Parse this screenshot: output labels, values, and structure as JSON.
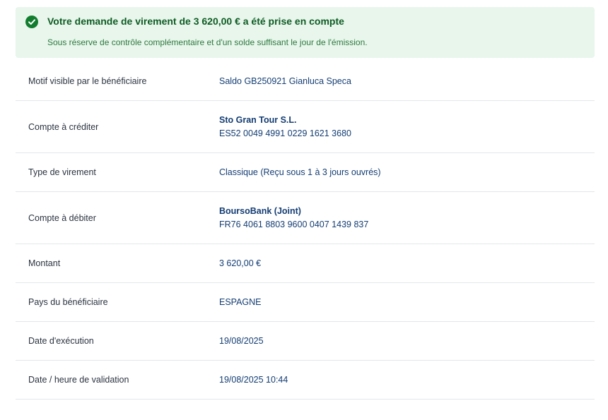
{
  "banner": {
    "title": "Votre demande de virement de 3 620,00 € a été prise en compte",
    "subtitle": "Sous réserve de contrôle complémentaire et d'un solde suffisant le jour de l'émission.",
    "icon": "check-circle-icon",
    "accent_color": "#127d2f",
    "background_color": "#e8f6ec"
  },
  "details": {
    "motif": {
      "label": "Motif visible par le bénéficiaire",
      "value": "Saldo GB250921 Gianluca Speca"
    },
    "compte_crediter": {
      "label": "Compte à créditer",
      "name": "Sto Gran Tour S.L.",
      "iban": "ES52 0049 4991 0229 1621 3680"
    },
    "type_virement": {
      "label": "Type de virement",
      "value": "Classique (Reçu sous 1 à 3 jours ouvrés)"
    },
    "compte_debiter": {
      "label": "Compte à débiter",
      "name": "BoursoBank (Joint)",
      "iban": "FR76 4061 8803 9600 0407 1439 837"
    },
    "montant": {
      "label": "Montant",
      "value": "3 620,00 €"
    },
    "pays": {
      "label": "Pays du bénéficiaire",
      "value": "ESPAGNE"
    },
    "date_execution": {
      "label": "Date d'exécution",
      "value": "19/08/2025"
    },
    "date_validation": {
      "label": "Date / heure de validation",
      "value": "19/08/2025 10:44"
    }
  }
}
